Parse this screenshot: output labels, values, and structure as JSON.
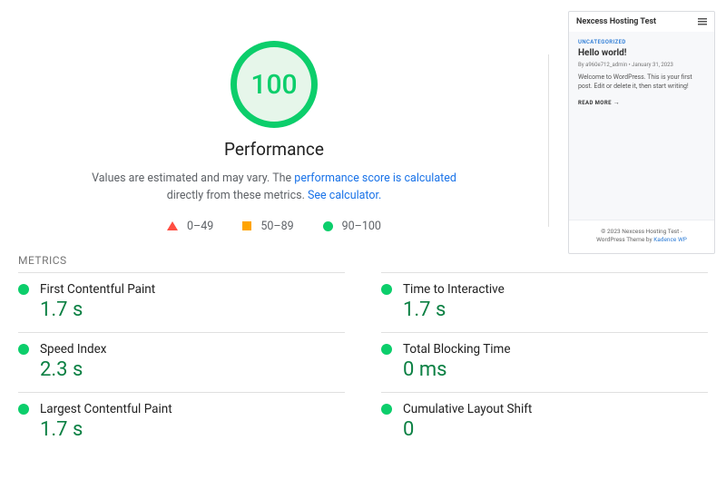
{
  "performance": {
    "score": "100",
    "title": "Performance",
    "desc_prefix": "Values are estimated and may vary. The ",
    "desc_link1": "performance score is calculated",
    "desc_mid": " directly from these metrics. ",
    "desc_link2": "See calculator.",
    "legend": {
      "poor": "0–49",
      "avg": "50–89",
      "good": "90–100"
    }
  },
  "thumbnail": {
    "site_title": "Nexcess Hosting Test",
    "category": "UNCATEGORIZED",
    "post_title": "Hello world!",
    "byline": "By a960e712_admin • January 31, 2023",
    "welcome": "Welcome to WordPress. This is your first post. Edit or delete it, then start writing!",
    "readmore": "READ MORE",
    "footer_line1": "© 2023 Nexcess Hosting Test -",
    "footer_line2_prefix": "WordPress Theme by ",
    "footer_link": "Kadence WP"
  },
  "metrics_header": "METRICS",
  "metrics": [
    {
      "name": "First Contentful Paint",
      "value": "1.7 s"
    },
    {
      "name": "Time to Interactive",
      "value": "1.7 s"
    },
    {
      "name": "Speed Index",
      "value": "2.3 s"
    },
    {
      "name": "Total Blocking Time",
      "value": "0 ms"
    },
    {
      "name": "Largest Contentful Paint",
      "value": "1.7 s"
    },
    {
      "name": "Cumulative Layout Shift",
      "value": "0"
    }
  ]
}
